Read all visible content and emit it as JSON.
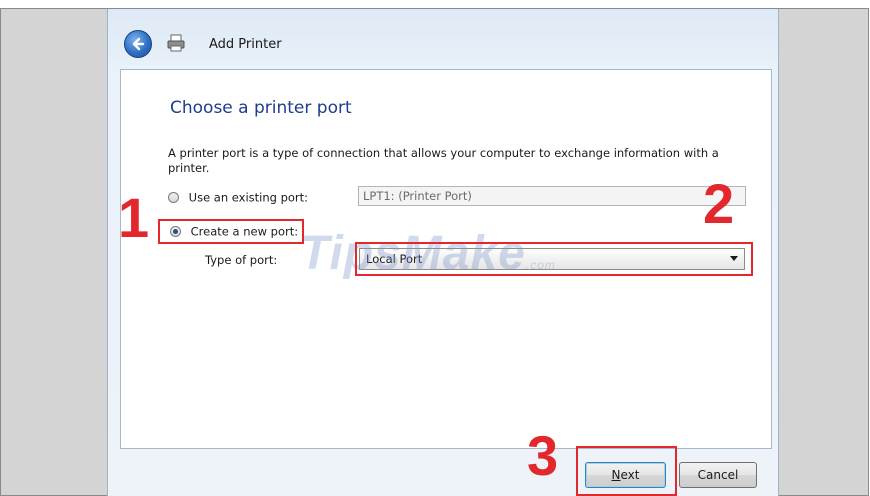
{
  "window": {
    "title": "Add Printer"
  },
  "page": {
    "heading": "Choose a printer port",
    "description": "A printer port is a type of connection that allows your computer to exchange information with a printer."
  },
  "options": {
    "existing_port_label": "Use an existing port:",
    "existing_port_value": "LPT1: (Printer Port)",
    "new_port_label": "Create a new port:",
    "type_of_port_label": "Type of port:",
    "type_of_port_value": "Local Port"
  },
  "annotations": {
    "step1": "1",
    "step2": "2",
    "step3": "3"
  },
  "watermark": {
    "main": "TipsMake",
    "suffix": ".com"
  },
  "buttons": {
    "next": "Next",
    "cancel": "Cancel"
  },
  "colors": {
    "annotation": "#e2282d",
    "heading": "#1e3d8f"
  },
  "icons": {
    "back": "back-arrow-icon",
    "printer": "printer-icon"
  }
}
